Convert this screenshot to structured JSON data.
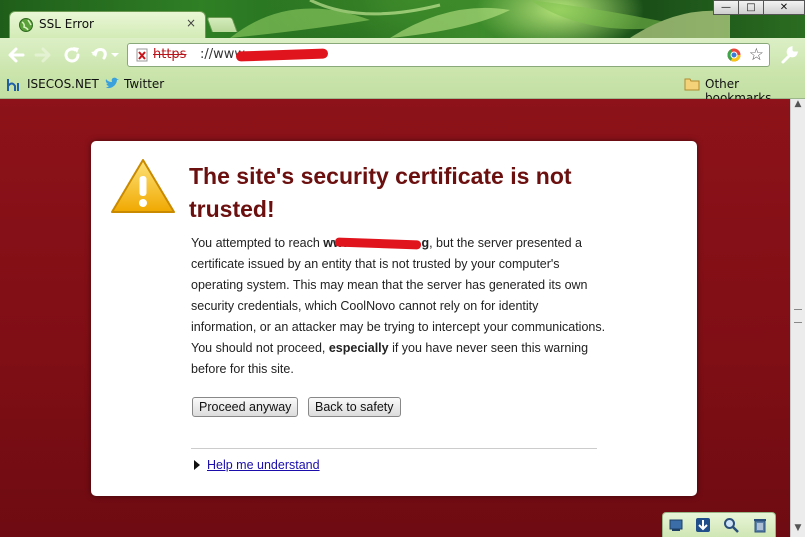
{
  "window": {
    "tab_title": "SSL Error",
    "tab_close": "×",
    "controls": [
      "minimize",
      "maximize",
      "close"
    ],
    "control_glyphs": [
      "—",
      "□",
      "✕"
    ]
  },
  "toolbar": {
    "url_scheme": "https",
    "url_rest": "://www.",
    "url_redacted": true
  },
  "bookmarks": {
    "items": [
      {
        "label": "ISECOS.NET",
        "icon": "isecos-icon"
      },
      {
        "label": "Twitter",
        "icon": "twitter-bird-icon"
      }
    ],
    "other_label": "Other bookmarks"
  },
  "interstitial": {
    "heading": "The site's security certificate is not trusted!",
    "body_prefix": "You attempted to reach ",
    "host_bold": "www.",
    "host_suffix": "g",
    "body_middle": ", but the server presented a certificate issued by an entity that is not trusted by your computer's operating system. This may mean that the server has generated its own security credentials, which CoolNovo cannot rely on for identity information, or an attacker may be trying to intercept your communications. You should not proceed, ",
    "body_emphasis": "especially",
    "body_suffix": " if you have never seen this warning before for this site.",
    "proceed_label": "Proceed anyway",
    "back_label": "Back to safety",
    "help_label": "Help me understand"
  },
  "extensions": {
    "icons": [
      "screen-capture-icon",
      "download-icon",
      "search-icon",
      "trash-icon"
    ]
  },
  "colors": {
    "page_bg": "#8a1218",
    "heading": "#6b0f0f",
    "link": "#1a0dab",
    "warning_yellow": "#f2b705"
  }
}
